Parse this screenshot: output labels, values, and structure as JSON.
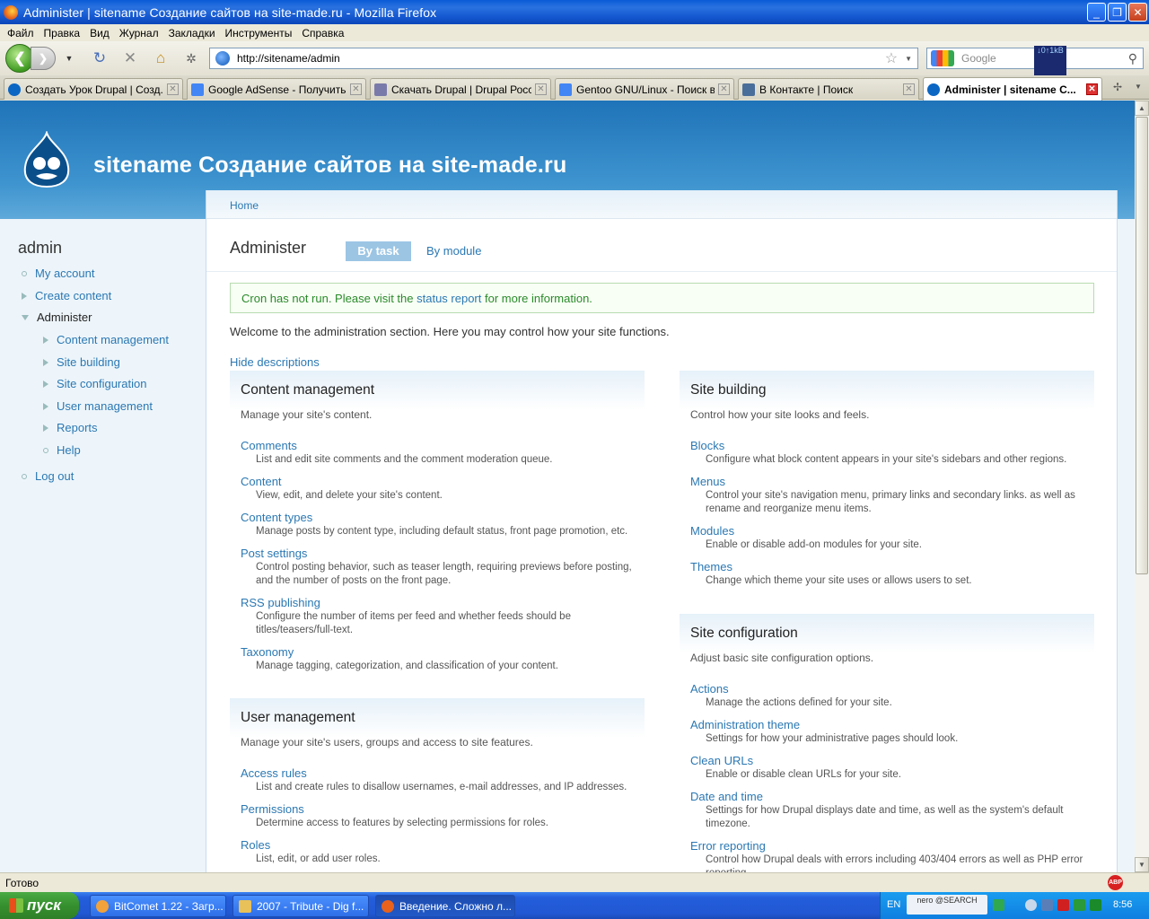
{
  "window": {
    "title": "Administer | sitename Создание сайтов на site-made.ru - Mozilla Firefox"
  },
  "menu": [
    "Файл",
    "Правка",
    "Вид",
    "Журнал",
    "Закладки",
    "Инструменты",
    "Справка"
  ],
  "navbar": {
    "url": "http://sitename/admin",
    "search_placeholder": "Google",
    "net_meter": "↓0↑1kB"
  },
  "tabs": [
    {
      "label": "Создать Урок Drupal | Созд...",
      "favicon_color": "#0b66c3"
    },
    {
      "label": "Google AdSense - Получить ...",
      "favicon_color": "#4285f4"
    },
    {
      "label": "Скачать Drupal | Drupal Росс...",
      "favicon_color": "#7a7aaa"
    },
    {
      "label": "Gentoo GNU/Linux - Поиск в ...",
      "favicon_color": "#4285f4"
    },
    {
      "label": "В Контакте | Поиск",
      "favicon_color": "#4a6e9a"
    },
    {
      "label": "Administer | sitename С...",
      "favicon_color": "#0b66c3"
    }
  ],
  "site": {
    "name": "sitename Создание сайтов на site-made.ru",
    "breadcrumb": "Home"
  },
  "sidebar": {
    "title": "admin",
    "items": [
      {
        "label": "My account",
        "level": 0,
        "marker": "bullet"
      },
      {
        "label": "Create content",
        "level": 0,
        "marker": "collapsed"
      },
      {
        "label": "Administer",
        "level": 0,
        "marker": "expanded"
      },
      {
        "label": "Content management",
        "level": 1,
        "marker": "collapsed"
      },
      {
        "label": "Site building",
        "level": 1,
        "marker": "collapsed"
      },
      {
        "label": "Site configuration",
        "level": 1,
        "marker": "collapsed"
      },
      {
        "label": "User management",
        "level": 1,
        "marker": "collapsed"
      },
      {
        "label": "Reports",
        "level": 1,
        "marker": "collapsed"
      },
      {
        "label": "Help",
        "level": 1,
        "marker": "bullet"
      },
      {
        "label": "Log out",
        "level": 0,
        "marker": "bullet"
      }
    ]
  },
  "main": {
    "title": "Administer",
    "tab_task": "By task",
    "tab_module": "By module",
    "cron_prefix": "Cron has not run. Please visit the ",
    "cron_link": "status report",
    "cron_suffix": " for more information.",
    "welcome": "Welcome to the administration section. Here you may control how your site functions.",
    "hide_descriptions": "Hide descriptions"
  },
  "panels": {
    "content_management": {
      "title": "Content management",
      "description": "Manage your site's content.",
      "items": [
        {
          "label": "Comments",
          "desc": "List and edit site comments and the comment moderation queue."
        },
        {
          "label": "Content",
          "desc": "View, edit, and delete your site's content."
        },
        {
          "label": "Content types",
          "desc": "Manage posts by content type, including default status, front page promotion, etc."
        },
        {
          "label": "Post settings",
          "desc": "Control posting behavior, such as teaser length, requiring previews before posting, and the number of posts on the front page."
        },
        {
          "label": "RSS publishing",
          "desc": "Configure the number of items per feed and whether feeds should be titles/teasers/full-text."
        },
        {
          "label": "Taxonomy",
          "desc": "Manage tagging, categorization, and classification of your content."
        }
      ]
    },
    "user_management": {
      "title": "User management",
      "description": "Manage your site's users, groups and access to site features.",
      "items": [
        {
          "label": "Access rules",
          "desc": "List and create rules to disallow usernames, e-mail addresses, and IP addresses."
        },
        {
          "label": "Permissions",
          "desc": "Determine access to features by selecting permissions for roles."
        },
        {
          "label": "Roles",
          "desc": "List, edit, or add user roles."
        }
      ]
    },
    "site_building": {
      "title": "Site building",
      "description": "Control how your site looks and feels.",
      "items": [
        {
          "label": "Blocks",
          "desc": "Configure what block content appears in your site's sidebars and other regions."
        },
        {
          "label": "Menus",
          "desc": "Control your site's navigation menu, primary links and secondary links. as well as rename and reorganize menu items."
        },
        {
          "label": "Modules",
          "desc": "Enable or disable add-on modules for your site."
        },
        {
          "label": "Themes",
          "desc": "Change which theme your site uses or allows users to set."
        }
      ]
    },
    "site_configuration": {
      "title": "Site configuration",
      "description": "Adjust basic site configuration options.",
      "items": [
        {
          "label": "Actions",
          "desc": "Manage the actions defined for your site."
        },
        {
          "label": "Administration theme",
          "desc": "Settings for how your administrative pages should look."
        },
        {
          "label": "Clean URLs",
          "desc": "Enable or disable clean URLs for your site."
        },
        {
          "label": "Date and time",
          "desc": "Settings for how Drupal displays date and time, as well as the system's default timezone."
        },
        {
          "label": "Error reporting",
          "desc": "Control how Drupal deals with errors including 403/404 errors as well as PHP error reporting."
        }
      ]
    }
  },
  "statusbar": {
    "text": "Готово"
  },
  "taskbar": {
    "start": "пуск",
    "tasks": [
      {
        "label": "BitComet 1.22 - Загр...",
        "icon_color": "#f2a23a"
      },
      {
        "label": "2007 - Tribute - Dig f...",
        "icon_color": "#e8c15a"
      },
      {
        "label": "Введение. Сложно л...",
        "icon_color": "#e8621c"
      }
    ],
    "language": "EN",
    "nero": "nero @SEARCH",
    "clock": "8:56"
  },
  "colors": {
    "link": "#2b78b3",
    "header": "#2d82c3",
    "cron_text": "#2a8a2a"
  }
}
